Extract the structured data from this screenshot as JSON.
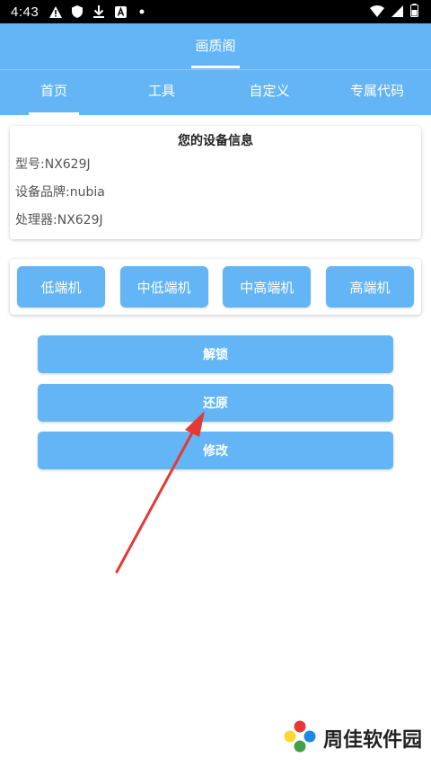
{
  "status_bar": {
    "time": "4:43",
    "icons_left": [
      "warning-icon",
      "shield-icon",
      "download-icon",
      "text-icon",
      "dot-icon"
    ],
    "icons_right": [
      "wifi-icon",
      "signal-icon",
      "battery-icon"
    ]
  },
  "app": {
    "title": "画质阁",
    "accent_color": "#64b5f6"
  },
  "tabs": [
    {
      "label": "首页",
      "active": true
    },
    {
      "label": "工具",
      "active": false
    },
    {
      "label": "自定义",
      "active": false
    },
    {
      "label": "专属代码",
      "active": false
    }
  ],
  "device_info": {
    "heading": "您的设备信息",
    "model": "型号:NX629J",
    "brand": "设备品牌:nubia",
    "processor": "处理器:NX629J"
  },
  "levels": [
    {
      "label": "低端机"
    },
    {
      "label": "中低端机"
    },
    {
      "label": "中高端机"
    },
    {
      "label": "高端机"
    }
  ],
  "actions": {
    "unlock": "解锁",
    "restore": "还原",
    "modify": "修改"
  },
  "watermark": {
    "text": "周佳软件园"
  }
}
